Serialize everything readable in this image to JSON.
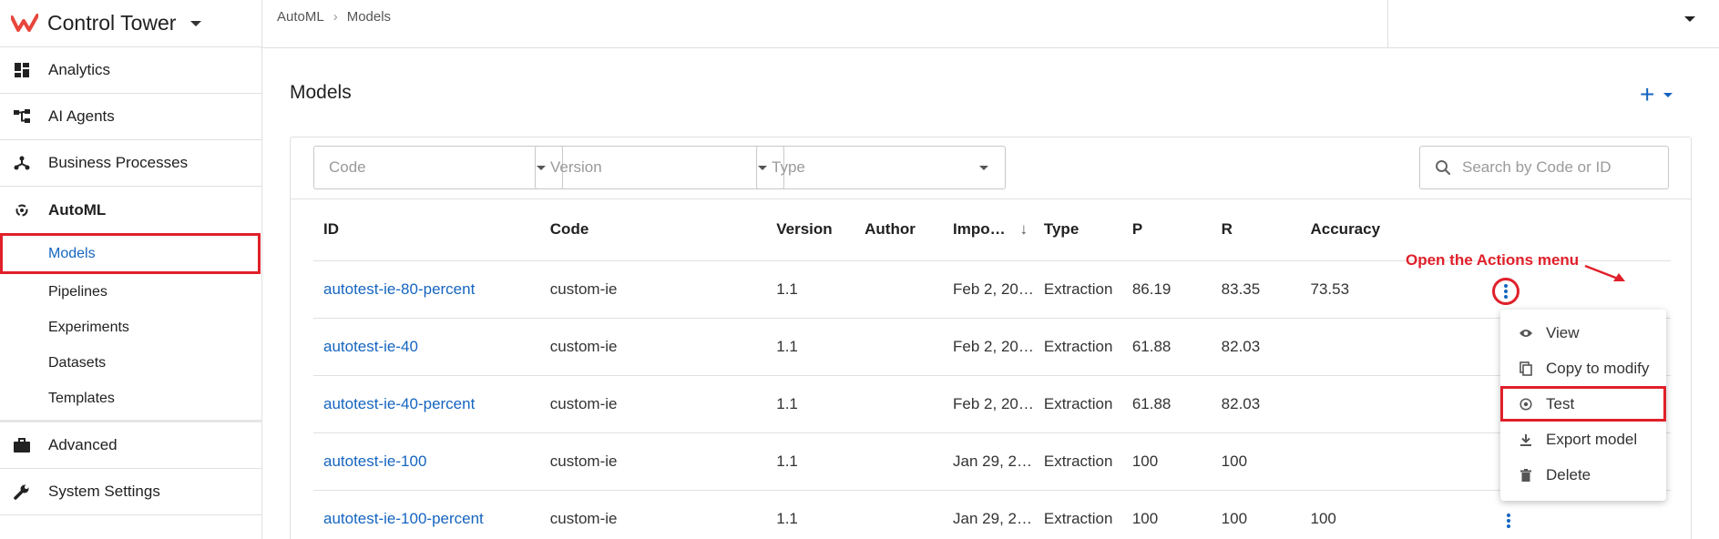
{
  "app": {
    "title": "Control Tower"
  },
  "sidebar": {
    "items": [
      {
        "label": "Analytics",
        "icon": "dashboard-icon"
      },
      {
        "label": "AI Agents",
        "icon": "flow-icon"
      },
      {
        "label": "Business Processes",
        "icon": "process-icon"
      },
      {
        "label": "AutoML",
        "icon": "automl-icon"
      }
    ],
    "automl_sub": [
      "Models",
      "Pipelines",
      "Experiments",
      "Datasets",
      "Templates"
    ],
    "bottom_items": [
      {
        "label": "Advanced",
        "icon": "briefcase-icon"
      },
      {
        "label": "System Settings",
        "icon": "wrench-icon"
      }
    ]
  },
  "breadcrumb": {
    "parent": "AutoML",
    "current": "Models"
  },
  "page": {
    "title": "Models",
    "add_label": "+"
  },
  "filters": {
    "code_placeholder": "Code",
    "version_placeholder": "Version",
    "type_placeholder": "Type",
    "search_placeholder": "Search by Code or ID"
  },
  "table": {
    "headers": [
      "ID",
      "Code",
      "Version",
      "Author",
      "Impo…",
      "Type",
      "P",
      "R",
      "Accuracy"
    ],
    "rows": [
      {
        "id": "autotest-ie-80-percent",
        "code": "custom-ie",
        "version": "1.1",
        "author": "",
        "imported": "Feb 2, 20…",
        "type": "Extraction",
        "p": "86.19",
        "r": "83.35",
        "accuracy": "73.53"
      },
      {
        "id": "autotest-ie-40",
        "code": "custom-ie",
        "version": "1.1",
        "author": "",
        "imported": "Feb 2, 20…",
        "type": "Extraction",
        "p": "61.88",
        "r": "82.03",
        "accuracy": ""
      },
      {
        "id": "autotest-ie-40-percent",
        "code": "custom-ie",
        "version": "1.1",
        "author": "",
        "imported": "Feb 2, 20…",
        "type": "Extraction",
        "p": "61.88",
        "r": "82.03",
        "accuracy": ""
      },
      {
        "id": "autotest-ie-100",
        "code": "custom-ie",
        "version": "1.1",
        "author": "",
        "imported": "Jan 29, 2…",
        "type": "Extraction",
        "p": "100",
        "r": "100",
        "accuracy": ""
      },
      {
        "id": "autotest-ie-100-percent",
        "code": "custom-ie",
        "version": "1.1",
        "author": "",
        "imported": "Jan 29, 2…",
        "type": "Extraction",
        "p": "100",
        "r": "100",
        "accuracy": "100"
      }
    ]
  },
  "annotation": {
    "text": "Open the Actions menu"
  },
  "actions_menu": {
    "items": [
      {
        "label": "View",
        "icon": "eye-icon"
      },
      {
        "label": "Copy to modify",
        "icon": "copy-icon"
      },
      {
        "label": "Test",
        "icon": "play-circle-icon"
      },
      {
        "label": "Export model",
        "icon": "download-icon"
      },
      {
        "label": "Delete",
        "icon": "trash-icon"
      }
    ]
  },
  "colors": {
    "accent": "#1565c0",
    "highlight": "#e0202a",
    "brand": "#e8453c"
  }
}
